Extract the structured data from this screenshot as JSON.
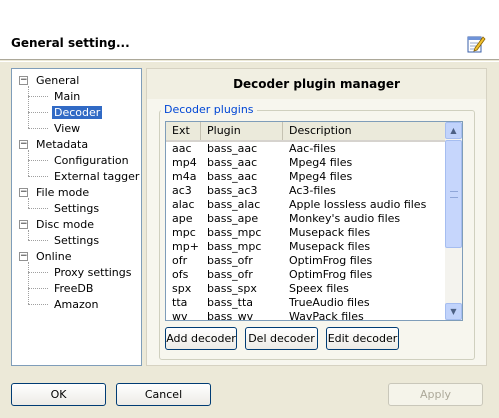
{
  "header": {
    "title": "General setting...",
    "icon": "edit-document-icon"
  },
  "tree": {
    "items": [
      {
        "label": "General",
        "level": 0,
        "expandable": true
      },
      {
        "label": "Main",
        "level": 1
      },
      {
        "label": "Decoder",
        "level": 1,
        "selected": true
      },
      {
        "label": "View",
        "level": 1
      },
      {
        "label": "Metadata",
        "level": 0,
        "expandable": true
      },
      {
        "label": "Configuration",
        "level": 1
      },
      {
        "label": "External tagger",
        "level": 1
      },
      {
        "label": "File mode",
        "level": 0,
        "expandable": true
      },
      {
        "label": "Settings",
        "level": 1
      },
      {
        "label": "Disc mode",
        "level": 0,
        "expandable": true
      },
      {
        "label": "Settings",
        "level": 1
      },
      {
        "label": "Online",
        "level": 0,
        "expandable": true
      },
      {
        "label": "Proxy settings",
        "level": 1
      },
      {
        "label": "FreeDB",
        "level": 1
      },
      {
        "label": "Amazon",
        "level": 1
      }
    ],
    "expand_symbol": "−"
  },
  "panel": {
    "title": "Decoder plugin manager",
    "group_title": "Decoder plugins",
    "columns": [
      "Ext",
      "Plugin",
      "Description"
    ],
    "rows": [
      [
        "aac",
        "bass_aac",
        "Aac-files"
      ],
      [
        "mp4",
        "bass_aac",
        "Mpeg4 files"
      ],
      [
        "m4a",
        "bass_aac",
        "Mpeg4 files"
      ],
      [
        "ac3",
        "bass_ac3",
        "Ac3-files"
      ],
      [
        "alac",
        "bass_alac",
        "Apple lossless audio files"
      ],
      [
        "ape",
        "bass_ape",
        "Monkey's audio files"
      ],
      [
        "mpc",
        "bass_mpc",
        "Musepack files"
      ],
      [
        "mp+",
        "bass_mpc",
        "Musepack files"
      ],
      [
        "ofr",
        "bass_ofr",
        "OptimFrog files"
      ],
      [
        "ofs",
        "bass_ofr",
        "OptimFrog files"
      ],
      [
        "spx",
        "bass_spx",
        "Speex files"
      ],
      [
        "tta",
        "bass_tta",
        "TrueAudio files"
      ],
      [
        "wv",
        "bass_wv",
        "WavPack files"
      ]
    ],
    "buttons": {
      "add": "Add decoder",
      "del": "Del decoder",
      "edit": "Edit decoder"
    }
  },
  "scrollbar": {
    "up": "▲",
    "down": "▼"
  },
  "footer": {
    "ok": "OK",
    "cancel": "Cancel",
    "apply": "Apply"
  }
}
